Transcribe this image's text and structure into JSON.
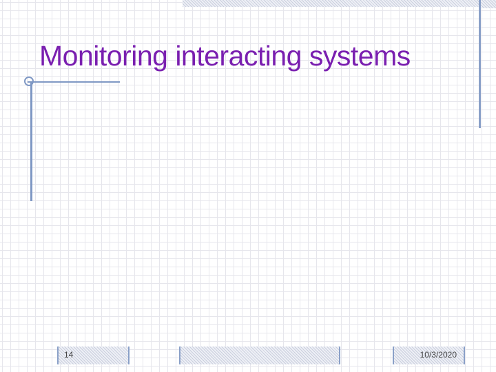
{
  "slide": {
    "title": "Monitoring interacting systems",
    "page_number": "14",
    "date": "10/3/2020"
  },
  "colors": {
    "title": "#7a1fb0",
    "rules": "#7f98c4",
    "grid": "#e6e6ec"
  }
}
